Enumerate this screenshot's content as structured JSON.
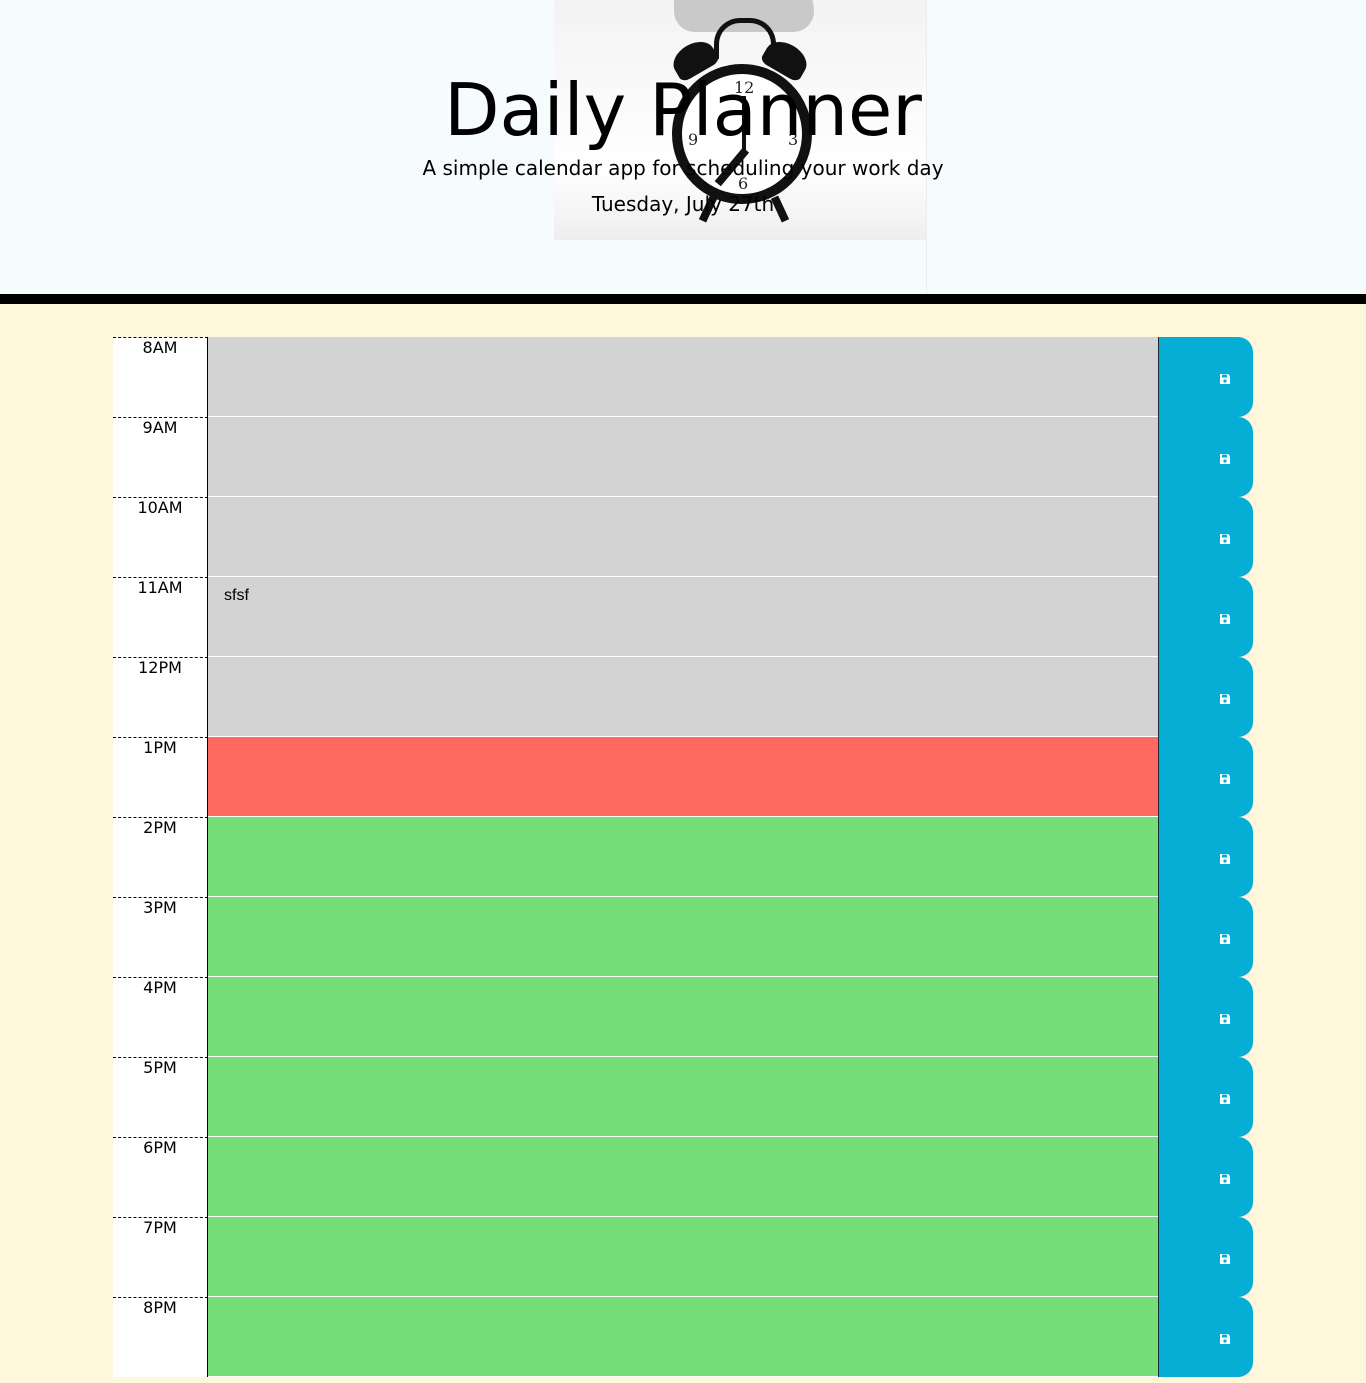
{
  "header": {
    "title": "Daily Planner",
    "subtitle": "A simple calendar app for scheduling your work day",
    "current_day": "Tuesday, July 27th"
  },
  "colors": {
    "past": "#d3d3d3",
    "present": "#ff6961",
    "future": "#77dd77",
    "save_button": "#06aed5"
  },
  "time_blocks": [
    {
      "hour": "8AM",
      "text": "",
      "state": "past",
      "save_icon": "floppy-disk-icon"
    },
    {
      "hour": "9AM",
      "text": "",
      "state": "past",
      "save_icon": "floppy-disk-icon"
    },
    {
      "hour": "10AM",
      "text": "",
      "state": "past",
      "save_icon": "floppy-disk-icon"
    },
    {
      "hour": "11AM",
      "text": "sfsf",
      "state": "past",
      "save_icon": "floppy-disk-icon"
    },
    {
      "hour": "12PM",
      "text": "",
      "state": "past",
      "save_icon": "floppy-disk-icon"
    },
    {
      "hour": "1PM",
      "text": "",
      "state": "present",
      "save_icon": "floppy-disk-icon"
    },
    {
      "hour": "2PM",
      "text": "",
      "state": "future",
      "save_icon": "floppy-disk-icon"
    },
    {
      "hour": "3PM",
      "text": "",
      "state": "future",
      "save_icon": "floppy-disk-icon"
    },
    {
      "hour": "4PM",
      "text": "",
      "state": "future",
      "save_icon": "floppy-disk-icon"
    },
    {
      "hour": "5PM",
      "text": "",
      "state": "future",
      "save_icon": "floppy-disk-icon"
    },
    {
      "hour": "6PM",
      "text": "",
      "state": "future",
      "save_icon": "floppy-disk-icon"
    },
    {
      "hour": "7PM",
      "text": "",
      "state": "future",
      "save_icon": "floppy-disk-icon"
    },
    {
      "hour": "8PM",
      "text": "",
      "state": "future",
      "save_icon": "floppy-disk-icon"
    }
  ]
}
